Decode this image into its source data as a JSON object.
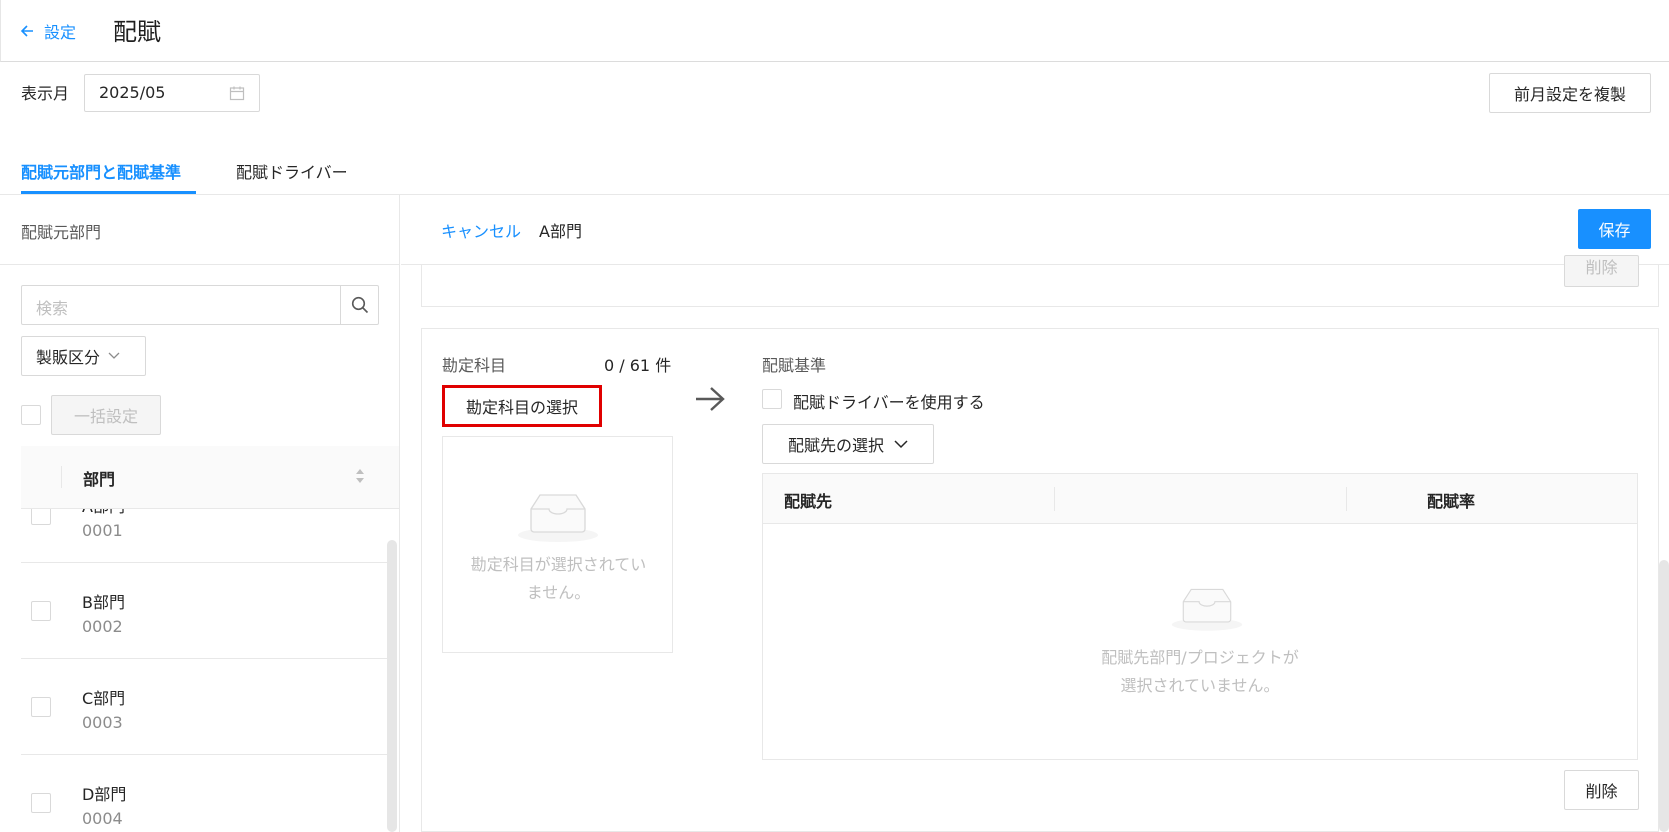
{
  "header": {
    "back_label": "設定",
    "title": "配賦"
  },
  "toolbar": {
    "month_label": "表示月",
    "month_value": "2025/05",
    "copy_button": "前月設定を複製"
  },
  "tabs": [
    {
      "label": "配賦元部門と配賦基準",
      "active": true
    },
    {
      "label": "配賦ドライバー",
      "active": false
    }
  ],
  "left": {
    "heading": "配賦元部門",
    "search_placeholder": "検索",
    "filter_label": "製販区分",
    "bulk_button": "一括設定",
    "column_label": "部門",
    "rows": [
      {
        "name": "A部門",
        "code": "0001"
      },
      {
        "name": "B部門",
        "code": "0002"
      },
      {
        "name": "C部門",
        "code": "0003"
      },
      {
        "name": "D部門",
        "code": "0004"
      }
    ]
  },
  "right": {
    "cancel_label": "キャンセル",
    "dept_name": "A部門",
    "save_button": "保存",
    "prev_delete": "削除",
    "accounts_label": "勘定科目",
    "accounts_count": "0 / 61 件",
    "select_accounts_button": "勘定科目の選択",
    "accounts_empty_line1": "勘定科目が選択されてい",
    "accounts_empty_line2": "ません。",
    "basis_label": "配賦基準",
    "use_driver_label": "配賦ドライバーを使用する",
    "select_dest_button": "配賦先の選択",
    "col_dest": "配賦先",
    "col_rate": "配賦率",
    "dest_empty_line1": "配賦先部門/プロジェクトが",
    "dest_empty_line2": "選択されていません。",
    "delete_button": "削除"
  },
  "colors": {
    "accent": "#1890ff",
    "highlight": "#e00000"
  }
}
